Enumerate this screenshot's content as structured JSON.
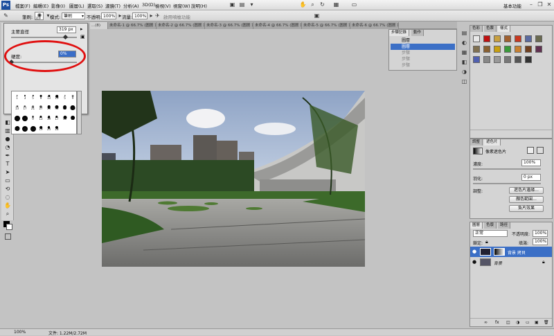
{
  "app": {
    "logo": "Ps",
    "workspace": "基本功能"
  },
  "menu": [
    "檔案(F)",
    "編輯(E)",
    "影像(I)",
    "圖層(L)",
    "選取(S)",
    "濾鏡(T)",
    "分析(A)",
    "3D(D)",
    "檢視(V)",
    "視窗(W)",
    "說明(H)"
  ],
  "options": {
    "brush_label": "筆刷:",
    "brush_size": "319",
    "mode_label": "模式:",
    "mode_value": "筆刷",
    "opacity_label": "不透明:",
    "opacity_value": "100%",
    "flow_label": "流量:",
    "flow_value": "100%",
    "airbrush_hint": "啟用噴槍功能"
  },
  "tabs": [
    "...(8)",
    "未命名-1 @ 66.7% (圖層 1, ...",
    "未命名-2 @ 66.7% (圖層 1, ...",
    "未命名-3 @ 66.7% (圖層 1, ...",
    "未命名-4 @ 66.7% (圖層 1, ...",
    "未命名-5 @ 66.7% (圖層 1, ...",
    "未命名-6 @ 66.7% (圖層 1, ..."
  ],
  "brush_popup": {
    "diameter_label": "主要直徑",
    "diameter_value": "319 px",
    "hardness_label": "硬度:",
    "hardness_value": "0%",
    "presets": [
      "1",
      "3",
      "5",
      "9",
      "13",
      "19",
      "5",
      "9",
      "13",
      "17",
      "21",
      "27",
      "35",
      "45",
      "65",
      "100",
      "200",
      "300",
      "9",
      "13",
      "19",
      "17",
      "45",
      "65",
      "100",
      "200",
      "300",
      "19",
      "24",
      "28"
    ]
  },
  "history_panel": {
    "tabs": [
      "步驟記錄",
      "動作"
    ],
    "items": [
      "圖層",
      "圖層",
      "步驟",
      "步驟",
      "步驟"
    ]
  },
  "color_panel": {
    "tabs": [
      "色彩",
      "色票",
      "樣式"
    ]
  },
  "swatches": [
    "#e8e8e8",
    "#c01010",
    "#c8a040",
    "#a06030",
    "#c83820",
    "#5a6aa0",
    "#6a6a50",
    "#807050",
    "#8a6030",
    "#c8a010",
    "#3a9a3a",
    "#c88030",
    "#704020",
    "#603050",
    "#5060b0",
    "#888888",
    "#999999",
    "#777777",
    "#555555",
    "#333333"
  ],
  "adjust_panel": {
    "tabs": [
      "調整",
      "遮色片"
    ],
    "mask_label": "像素遮色片",
    "density_label": "濃度:",
    "density_value": "100%",
    "feather_label": "羽化:",
    "feather_value": "0 px",
    "refine_label": "調整:",
    "btn_edge": "遮色片邊緣...",
    "btn_color": "顏色範圍...",
    "btn_invert": "負片效果"
  },
  "layers_panel": {
    "tabs": [
      "圖層",
      "色版",
      "路徑"
    ],
    "blend_mode": "正常",
    "opacity_label": "不透明度:",
    "opacity_value": "100%",
    "lock_label": "鎖定:",
    "fill_label": "填滿:",
    "fill_value": "100%",
    "layers": [
      {
        "name": "背景 拷貝",
        "selected": true
      },
      {
        "name": "背景",
        "selected": false
      }
    ]
  },
  "status": {
    "zoom": "100%",
    "doc": "文件: 1.22M/2.72M"
  }
}
